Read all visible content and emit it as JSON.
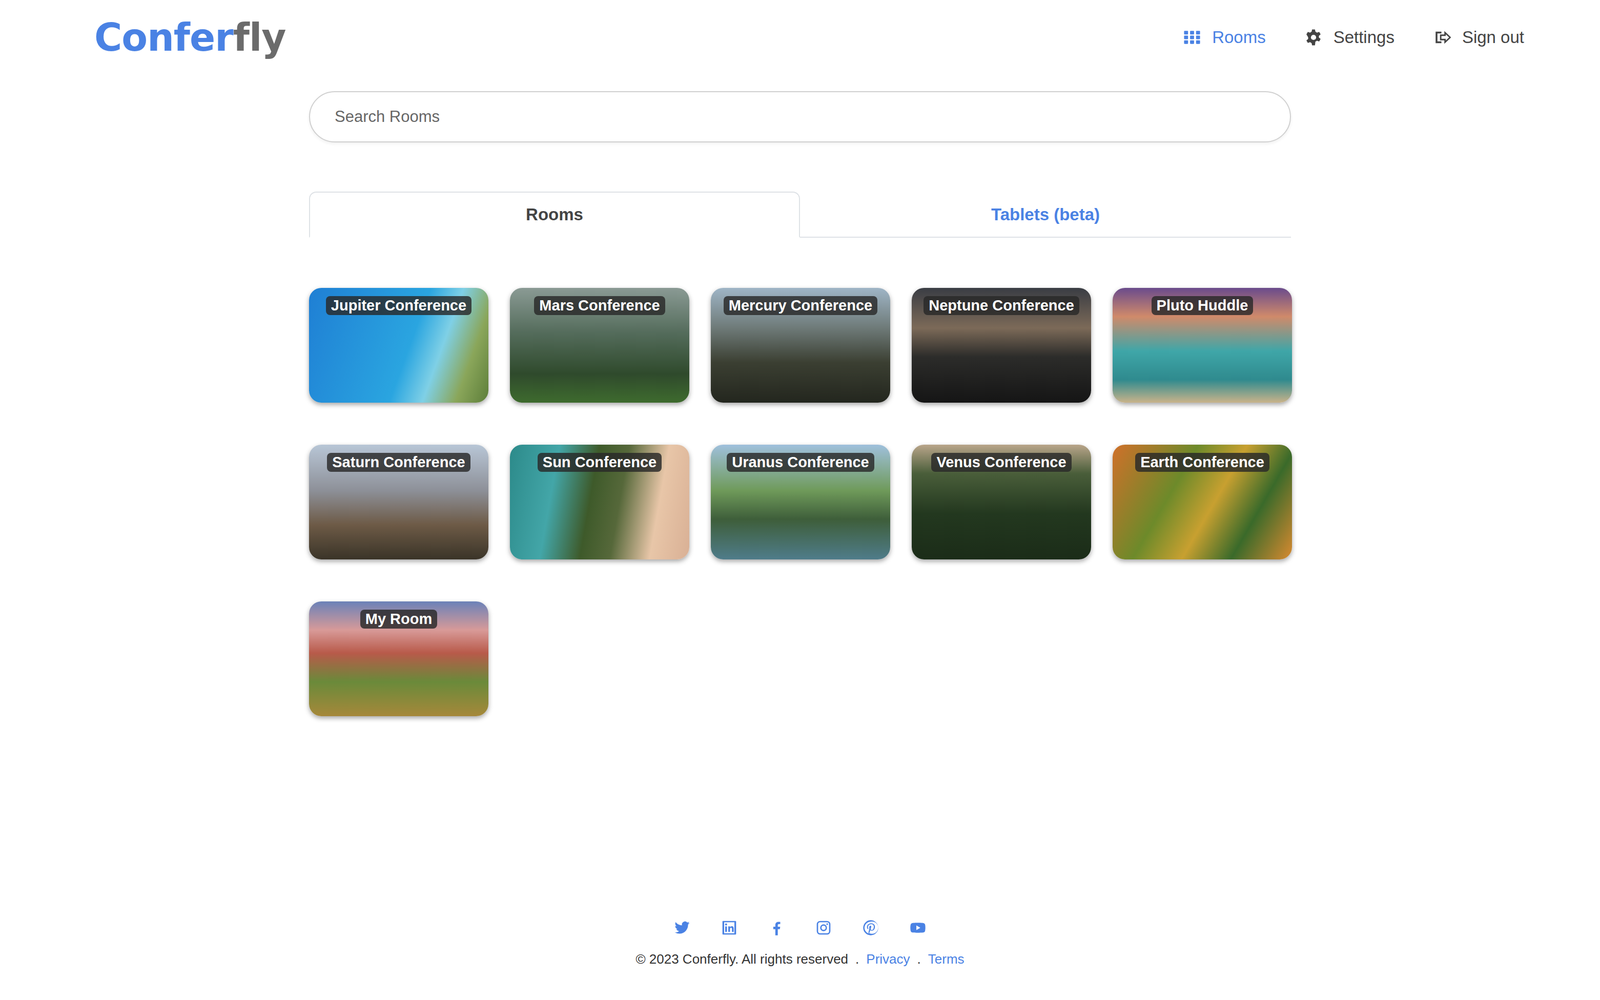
{
  "logo": {
    "primary": "Confer",
    "secondary": "fly"
  },
  "nav": [
    {
      "label": "Rooms",
      "selected": true,
      "kind": "grid"
    },
    {
      "label": "Settings",
      "selected": false,
      "kind": "gear"
    },
    {
      "label": "Sign out",
      "selected": false,
      "kind": "signout"
    }
  ],
  "search": {
    "placeholder": "Search Rooms"
  },
  "tabs": [
    {
      "label": "Rooms",
      "selected": true
    },
    {
      "label": "Tablets (beta)",
      "selected": false
    }
  ],
  "rooms": [
    {
      "name": "Jupiter Conference"
    },
    {
      "name": "Mars Conference"
    },
    {
      "name": "Mercury Conference"
    },
    {
      "name": "Neptune Conference"
    },
    {
      "name": "Pluto Huddle"
    },
    {
      "name": "Saturn Conference"
    },
    {
      "name": "Sun Conference"
    },
    {
      "name": "Uranus Conference"
    },
    {
      "name": "Venus Conference"
    },
    {
      "name": "Earth Conference"
    },
    {
      "name": "My Room"
    }
  ],
  "footer": {
    "social": [
      {
        "kind": "twitter"
      },
      {
        "kind": "linkedin"
      },
      {
        "kind": "facebook"
      },
      {
        "kind": "instagram"
      },
      {
        "kind": "pinterest"
      },
      {
        "kind": "youtube"
      }
    ],
    "copyright": "© 2023 Conferfly. All rights reserved",
    "separator": ".",
    "links": [
      {
        "label": "Privacy"
      },
      {
        "label": "Terms"
      }
    ]
  }
}
